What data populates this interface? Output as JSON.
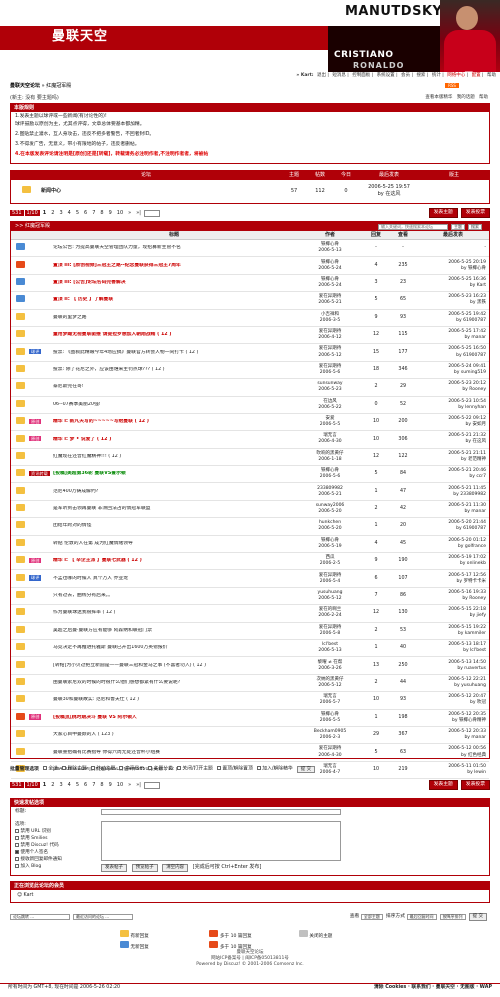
{
  "header": {
    "logo_cn": "曼联天空",
    "logo_en": "MANUTDSKY",
    "player_name_1": "CRISTIANO",
    "player_name_2": "RONALDO",
    "shirt_number": "7"
  },
  "top_nav": {
    "user": "» Kart:",
    "items": [
      "退出",
      "短消息",
      "控制面板",
      "系统设置",
      "会员",
      "搜索",
      "统计",
      "网络中心",
      "配置",
      "帮助"
    ]
  },
  "breadcrumb": {
    "site": "曼联天空论坛",
    "separator": " » ",
    "forum": "红魔冠军殿"
  },
  "subbar": {
    "left": "(新主: 没有 要主题吗)",
    "rss": "RSS",
    "right_1": "查看本版精华",
    "right_2": "我的话题",
    "right_3": "帮助"
  },
  "notice": {
    "title": "本版规则",
    "lines": [
      "1.发表主题以球评或一些新闻(有讨论性的)!",
      "球评鼓励以原创为主，尤其点评得，文章总体要基本都加精。",
      "2.图贴禁止灌水，互人身攻击，违反不把多者警告，不回者封ID。",
      "3.不得发广告，无意义，带小有限地的帖子，违反者删帖。",
      "4.在本版发表评论请注明是[原创]还是[转载]，转载请务必注明作者,不注明作者者，将被帖"
    ]
  },
  "forum_table": {
    "cols": [
      "论坛",
      "主题",
      "帖数",
      "今日",
      "最后发表",
      "版主"
    ],
    "row": {
      "name": "新闻中心",
      "topics": "57",
      "posts": "112",
      "today": "0",
      "last_post_date": "2006-5-25 19:57",
      "last_post_by": "by 在这风",
      "moderator": ""
    }
  },
  "pager": {
    "count": "531",
    "page_of": "1/10",
    "pages": [
      "1",
      "2",
      "3",
      "4",
      "5",
      "6",
      "7",
      "8",
      "9",
      "10"
    ],
    "next": "»",
    "last": "»|",
    "new_topic": "发表主题",
    "new_poll": "发表投票"
  },
  "thread_list": {
    "title": ">> 红魔冠军殿",
    "search_placeholder": "输入关键词，快速搜索本论坛",
    "scope": "主题",
    "search_btn": "搜索",
    "cols": [
      "标题",
      "作者",
      "回复",
      "查看",
      "最后发表"
    ],
    "rows": [
      {
        "tag": "",
        "title": "论坛公告: 为提高曼联天空管理团队力量，现招募新主管不名",
        "author": "铁椰心骨",
        "date": "2006-5-13",
        "replies": "-",
        "views": "-",
        "last": "-",
        "last_by": "",
        "style": "",
        "icon": "top"
      },
      {
        "tag": "",
        "title": "置顶 III: [原创视频]三冠王之路--纪念曼联获得三冠王7周年",
        "author": "铁椰心骨",
        "date": "2006-5-24",
        "replies": "4",
        "views": "235",
        "last": "2006-5-25 20:19",
        "last_by": "by 铁椰心骨",
        "style": "red",
        "icon": "hot"
      },
      {
        "tag": "",
        "title": "置顶 III: [公告]论坛名码完善解决",
        "author": "铁椰心骨",
        "date": "2006-5-24",
        "replies": "3",
        "views": "23",
        "last": "2006-5-25 16:36",
        "last_by": "by Kart",
        "style": "red",
        "icon": "top"
      },
      {
        "tag": "",
        "title": "置顶 II: 【 历史 】了解曼联",
        "author": "爱在异期待",
        "date": "2006-5-21",
        "replies": "5",
        "views": "65",
        "last": "2006-5-23 16:23",
        "last_by": "by 黑铁",
        "style": "red",
        "icon": "top"
      },
      {
        "tag": "",
        "title": "曼联的里梦之路",
        "author": "小吉祥和",
        "date": "2006-3-5",
        "replies": "9",
        "views": "93",
        "last": "2006-5-25 19:42",
        "last_by": "by 61900787",
        "style": "",
        "icon": "normal"
      },
      {
        "tag": "",
        "title": "量用梦踢无视曼联驱维 请提拉罗想加入朝翔战贿 ( 12 )",
        "author": "爱在异期待",
        "date": "2006-4-12",
        "replies": "12",
        "views": "115",
        "last": "2006-5-25 17:42",
        "last_by": "by manar",
        "style": "red",
        "icon": "normal"
      },
      {
        "tag": "球评",
        "title": "投票: 《图叙此精眼今年4场应搞》曼联官方转会人物一同打卡 ( 12 )",
        "author": "爱在异期待",
        "date": "2006-5-12",
        "replies": "15",
        "views": "177",
        "last": "2006-5-25 16:50",
        "last_by": "by 61900787",
        "style": "",
        "icon": "normal"
      },
      {
        "tag": "",
        "title": "投票: 除了花尼之外，应该由谁来主罚点球??? ( 12 )",
        "author": "爱在异期待",
        "date": "2006-5-6",
        "replies": "18",
        "views": "346",
        "last": "2006-5-24 09:41",
        "last_by": "by suming519",
        "style": "",
        "icon": "normal"
      },
      {
        "tag": "",
        "title": "泰尼斯完在哥!",
        "author": "sunsunway",
        "date": "2006-5-23",
        "replies": "2",
        "views": "29",
        "last": "2006-5-23 20:12",
        "last_by": "by Rooney",
        "style": "",
        "icon": "normal"
      },
      {
        "tag": "",
        "title": "06--07赛季美丽20强!",
        "author": "在边风",
        "date": "2006-5-22",
        "replies": "0",
        "views": "52",
        "last": "2006-5-23 10:54",
        "last_by": "by lennyhan",
        "style": "",
        "icon": "normal"
      },
      {
        "tag": "原创",
        "title": "精华 I: 新凡天写的~~~~~写给曼联 ( 12 )",
        "author": "安爱",
        "date": "2006-5-5",
        "replies": "10",
        "views": "200",
        "last": "2006-5-22 09:12",
        "last_by": "by 安如月",
        "style": "red",
        "icon": "normal"
      },
      {
        "tag": "原创",
        "title": "精华 I: 梦 • 说爱了 ( 12 )",
        "author": "瑞无言",
        "date": "2006-4-30",
        "replies": "10",
        "views": "306",
        "last": "2006-5-21 21:32",
        "last_by": "by 在这风",
        "style": "red",
        "icon": "normal"
      },
      {
        "tag": "",
        "title": "红魔现在还曾红魔精神!!! ( 12 )",
        "author": "吹响的黑黄仔",
        "date": "2006-1-18",
        "replies": "12",
        "views": "122",
        "last": "2006-5-21 21:11",
        "last_by": "by 老范精神",
        "style": "",
        "icon": "normal"
      },
      {
        "tag": "资讯转载",
        "title": "[投稿]美超第36轮 曼联VS查尔顿",
        "author": "铁椰心骨",
        "date": "2006-5-6",
        "replies": "5",
        "views": "84",
        "last": "2006-5-21 20:46",
        "last_by": "by ccr7",
        "style": "grn",
        "icon": "normal"
      },
      {
        "tag": "",
        "title": "范尼400万铸成解约?",
        "author": "233809982",
        "date": "2006-5-21",
        "replies": "1",
        "views": "47",
        "last": "2006-5-21 11:45",
        "last_by": "by 233809982",
        "style": "",
        "icon": "normal"
      },
      {
        "tag": "",
        "title": "是军听到击领再曼联 非洲回法占的情冠军联盟",
        "author": "sunway2006",
        "date": "2006-5-20",
        "replies": "2",
        "views": "42",
        "last": "2006-5-21 11:30",
        "last_by": "by manar",
        "style": "",
        "icon": "normal"
      },
      {
        "tag": "",
        "title": "团结年跨对的情怪",
        "author": "hunkchen",
        "date": "2006-5-20",
        "replies": "1",
        "views": "20",
        "last": "2006-5-20 21:44",
        "last_by": "by 61900787",
        "style": "",
        "icon": "normal"
      },
      {
        "tag": "",
        "title": "转贴 伦敦的人在第 成为红魔情绪领导",
        "author": "铁椰心骨",
        "date": "2006-5-19",
        "replies": "4",
        "views": "45",
        "last": "2006-5-20 01:12",
        "last_by": "by golfrance",
        "style": "",
        "icon": "normal"
      },
      {
        "tag": "原创",
        "title": "精华 I: 【 辛企王派 】曼联七武器 ( 12 )",
        "author": "西瓜",
        "date": "2006-2-5",
        "replies": "9",
        "views": "190",
        "last": "2006-5-19 17:02",
        "last_by": "by onlinekb",
        "style": "red",
        "icon": "normal"
      },
      {
        "tag": "球评",
        "title": "不孟也哪的时候人 真个万人 乔亚龙",
        "author": "爱在异期待",
        "date": "2006-5-4",
        "replies": "6",
        "views": "107",
        "last": "2006-5-17 12:56",
        "last_by": "by 罗特卡卡米",
        "style": "",
        "icon": "normal"
      },
      {
        "tag": "",
        "title": "只有过去，曲线分有后来。。",
        "author": "yusuhuang",
        "date": "2006-5-12",
        "replies": "7",
        "views": "86",
        "last": "2006-5-16 19:33",
        "last_by": "by Rooney",
        "style": "",
        "icon": "normal"
      },
      {
        "tag": "",
        "title": "作为曼联球迷我很挥率 ( 12 )",
        "author": "爱在的啊兰",
        "date": "2006-2-24",
        "replies": "12",
        "views": "130",
        "last": "2006-5-15 22:18",
        "last_by": "by jiefy",
        "style": "",
        "icon": "normal"
      },
      {
        "tag": "",
        "title": "吴超之后曼·曼联方应有能够 阿森纳和联冠门票",
        "author": "爱在异期待",
        "date": "2006-5-8",
        "replies": "2",
        "views": "53",
        "last": "2006-5-15 19:22",
        "last_by": "by kammiler",
        "style": "",
        "icon": "normal"
      },
      {
        "tag": "",
        "title": "马竞决定不再推进托雅斯 曼联已开出1600万英镑报价",
        "author": "lcl'best",
        "date": "2006-5-13",
        "replies": "1",
        "views": "40",
        "last": "2006-5-13 18:17",
        "last_by": "by lcl'best",
        "style": "",
        "icon": "normal"
      },
      {
        "tag": "",
        "title": "[转帖]为小贝过把立新圆是——曼联三冠和金马之事 (不喜者勿入) ( 12 )",
        "author": "黎曜 ≠ 在帮",
        "date": "2006-3-26",
        "replies": "13",
        "views": "250",
        "last": "2006-5-13 14:50",
        "last_by": "by ruavertus",
        "style": "",
        "icon": "normal"
      },
      {
        "tag": "",
        "title": "由曼联索尼双的时候的时很什么他们感想都紧有什么要说呢?",
        "author": "次纳的黑黄仔",
        "date": "2006-5-12",
        "replies": "2",
        "views": "44",
        "last": "2006-5-12 22:21",
        "last_by": "by yusuhuang",
        "style": "",
        "icon": "normal"
      },
      {
        "tag": "",
        "title": "曼联30和曼联故实: 范尼和鲁夫仕 ( 12 )",
        "author": "瑞无言",
        "date": "2006-5-7",
        "replies": "10",
        "views": "93",
        "last": "2006-5-12 20:47",
        "last_by": "by 吹冠",
        "style": "",
        "icon": "normal"
      },
      {
        "tag": "原创",
        "title": "[投稿]红桃时期决斗 曼联 VS 阿尔顿人",
        "author": "铁椰心骨",
        "date": "2006-5-5",
        "replies": "1",
        "views": "198",
        "last": "2006-5-12 20:35",
        "last_by": "by 铁椰心骨精神",
        "style": "red",
        "icon": "hot"
      },
      {
        "tag": "",
        "title": "大家心目中曼颇的人 ( 123 )",
        "author": "Beckham0905",
        "date": "2006-2-3",
        "replies": "29",
        "views": "367",
        "last": "2006-5-12 20:33",
        "last_by": "by manar",
        "style": "",
        "icon": "normal"
      },
      {
        "tag": "",
        "title": "曼联重拾确有比赛指导 你得六周无处还曾杯小组赛",
        "author": "爱在异期待",
        "date": "2006-4-30",
        "replies": "5",
        "views": "63",
        "last": "2006-5-12 00:56",
        "last_by": "by 红色经典",
        "style": "",
        "icon": "normal"
      },
      {
        "tag": "",
        "title": "[MANUTD.COM]我们是的ASL份值4伴5650万英镑 ( 12 )",
        "author": "瑞无言",
        "date": "2006-4-7",
        "replies": "10",
        "views": "219",
        "last": "2006-5-11 01:50",
        "last_by": "by lewin",
        "style": "",
        "icon": "normal"
      }
    ]
  },
  "admin_bar": {
    "label": "批量管理选项",
    "options": [
      "全选",
      "删除主题",
      "移动主题",
      "高亮显示",
      "主题分类",
      "关闭/打开主题",
      "置顶/解除置顶",
      "加入/解除精华"
    ],
    "submit": "提 交"
  },
  "quick_post": {
    "title": "快速发帖选项",
    "label_title": "标题:",
    "label_options": "选项:",
    "options": [
      "禁用 URL 识别",
      "禁用 Smilies",
      "禁用 Discuz! 代码",
      "使用个人签名",
      "接收新回复邮件通知",
      "加入 Blog"
    ],
    "btn_post": "发表帖子",
    "btn_preview": "预览帖子",
    "btn_clear": "清空内容",
    "hint": "[完成后可按 Ctrl+Enter 发布]"
  },
  "online": {
    "title": "正在浏览此论坛的会员",
    "users": [
      "Kart"
    ]
  },
  "footer_controls": {
    "jump_label": "论坛跳转 ...",
    "recent_label": "最近访问的论坛 ...",
    "view_label": "查看",
    "view_value": "全部主题",
    "order_label": "排序方式",
    "order_value": "最后回复时间",
    "order_dir": "按降序排列",
    "submit": "提 交"
  },
  "legend": {
    "items": [
      "有新回复",
      "多于 10 篇回复",
      "关闭的主题",
      "无新回复",
      "多于 10 篇回复"
    ]
  },
  "powered": {
    "line1": "曼联天空论坛",
    "line2": "网站ICP备案号 | 闽ICP备05013811号",
    "line3": "Powered by Discuz! © 2001-2006 Comsenz Inc."
  },
  "footer": {
    "left": "所有时间为 GMT+8, 现在时间是 2006-5-26 02:20",
    "right": "清除 Cookies · 联系我们 · 曼联天空 · 无图版 · WAP"
  }
}
